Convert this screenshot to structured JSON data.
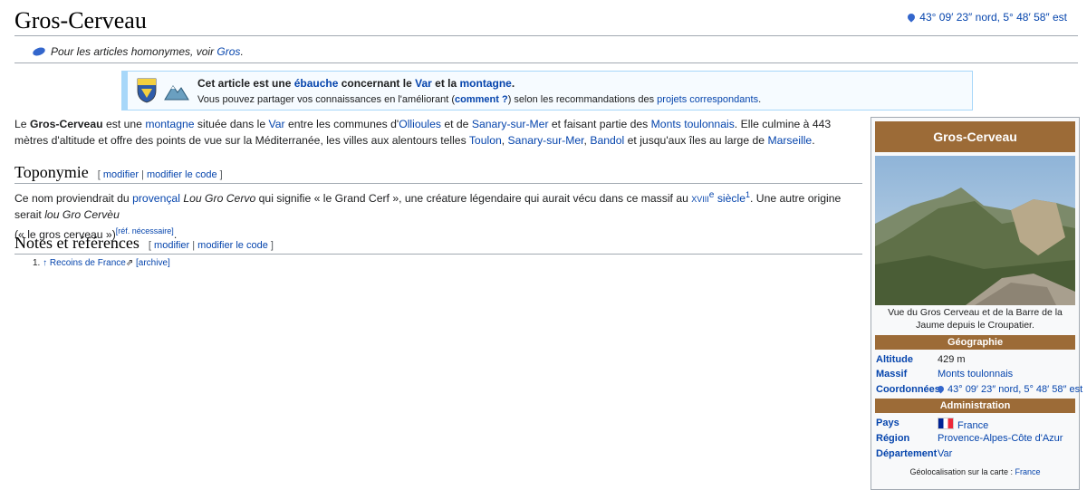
{
  "page": {
    "title": "Gros-Cerveau",
    "coordinates": "43° 09′ 23″ nord, 5° 48′ 58″ est"
  },
  "hatnote": {
    "prefix": "Pour les articles homonymes, voir",
    "link": "Gros",
    "suffix": "."
  },
  "ebauche": {
    "l1_a": "Cet article est une",
    "l1_link1": "ébauche",
    "l1_b": "concernant le",
    "l1_link2": "Var",
    "l1_c": "et la",
    "l1_link3": "montagne",
    "l1_d": ".",
    "l2_a": "Vous pouvez partager vos connaissances en l'améliorant (",
    "l2_link1": "comment ?",
    "l2_b": ") selon les recommandations des",
    "l2_link2": "projets correspondants",
    "l2_c": "."
  },
  "intro": {
    "t1": "Le ",
    "bold": "Gros-Cerveau",
    "t2": " est une ",
    "l_montagne": "montagne",
    "t3": " située dans le ",
    "l_var": "Var",
    "t4": " entre les communes d'",
    "l_ollioules": "Ollioules",
    "t5": " et de ",
    "l_sanary": "Sanary-sur-Mer",
    "t6": " et faisant partie des ",
    "l_monts": "Monts toulonnais",
    "t7": ". Elle culmine à 443 mètres d'altitude et offre des points de vue sur la Méditerranée, les villes aux alentours telles ",
    "l_toulon": "Toulon",
    "t8": ", ",
    "l_sanary2": "Sanary-sur-Mer",
    "t9": ", ",
    "l_bandol": "Bandol",
    "t10": " et jusqu'aux îles au large de ",
    "l_marseille": "Marseille",
    "t11": "."
  },
  "toponymie": {
    "heading": "Toponymie",
    "edit1": "modifier",
    "edit2": "modifier le code",
    "t1": "Ce nom proviendrait du ",
    "l_provencal": "provençal",
    "t2": " ",
    "i1": "Lou Gro Cervo",
    "t3": " qui signifie « le Grand Cerf », une créature légendaire qui aurait vécu dans ce massif au ",
    "l_siecle_a": "xviii",
    "l_siecle_e": "e",
    "l_siecle_b": " siècle",
    "ref1": "1",
    "t4": ". Une autre origine serait ",
    "i2": "lou Gro Cervèu",
    "t5": " (« le gros cerveau »)",
    "refneeded": "[réf. nécessaire]",
    "t6": "."
  },
  "notes": {
    "heading": "Notes et références",
    "edit1": "modifier",
    "edit2": "modifier le code",
    "item_num": "1.",
    "item_arrow": "↑",
    "item_link": "Recoins de France",
    "item_archive": "[archive]"
  },
  "infobox": {
    "title": "Gros-Cerveau",
    "caption": "Vue du Gros Cerveau et de la Barre de la Jaume depuis le Croupatier.",
    "geo_header": "Géographie",
    "altitude_k": "Altitude",
    "altitude_v": "429 m",
    "massif_k": "Massif",
    "massif_v": "Monts toulonnais",
    "coord_k": "Coordonnées",
    "coord_v": "43° 09′ 23″ nord, 5° 48′ 58″ est",
    "admin_header": "Administration",
    "pays_k": "Pays",
    "pays_v": "France",
    "region_k": "Région",
    "region_v": "Provence-Alpes-Côte d'Azur",
    "dept_k": "Département",
    "dept_v": "Var",
    "geoloc_prefix": "Géolocalisation sur la carte :",
    "geoloc_link": "France"
  }
}
